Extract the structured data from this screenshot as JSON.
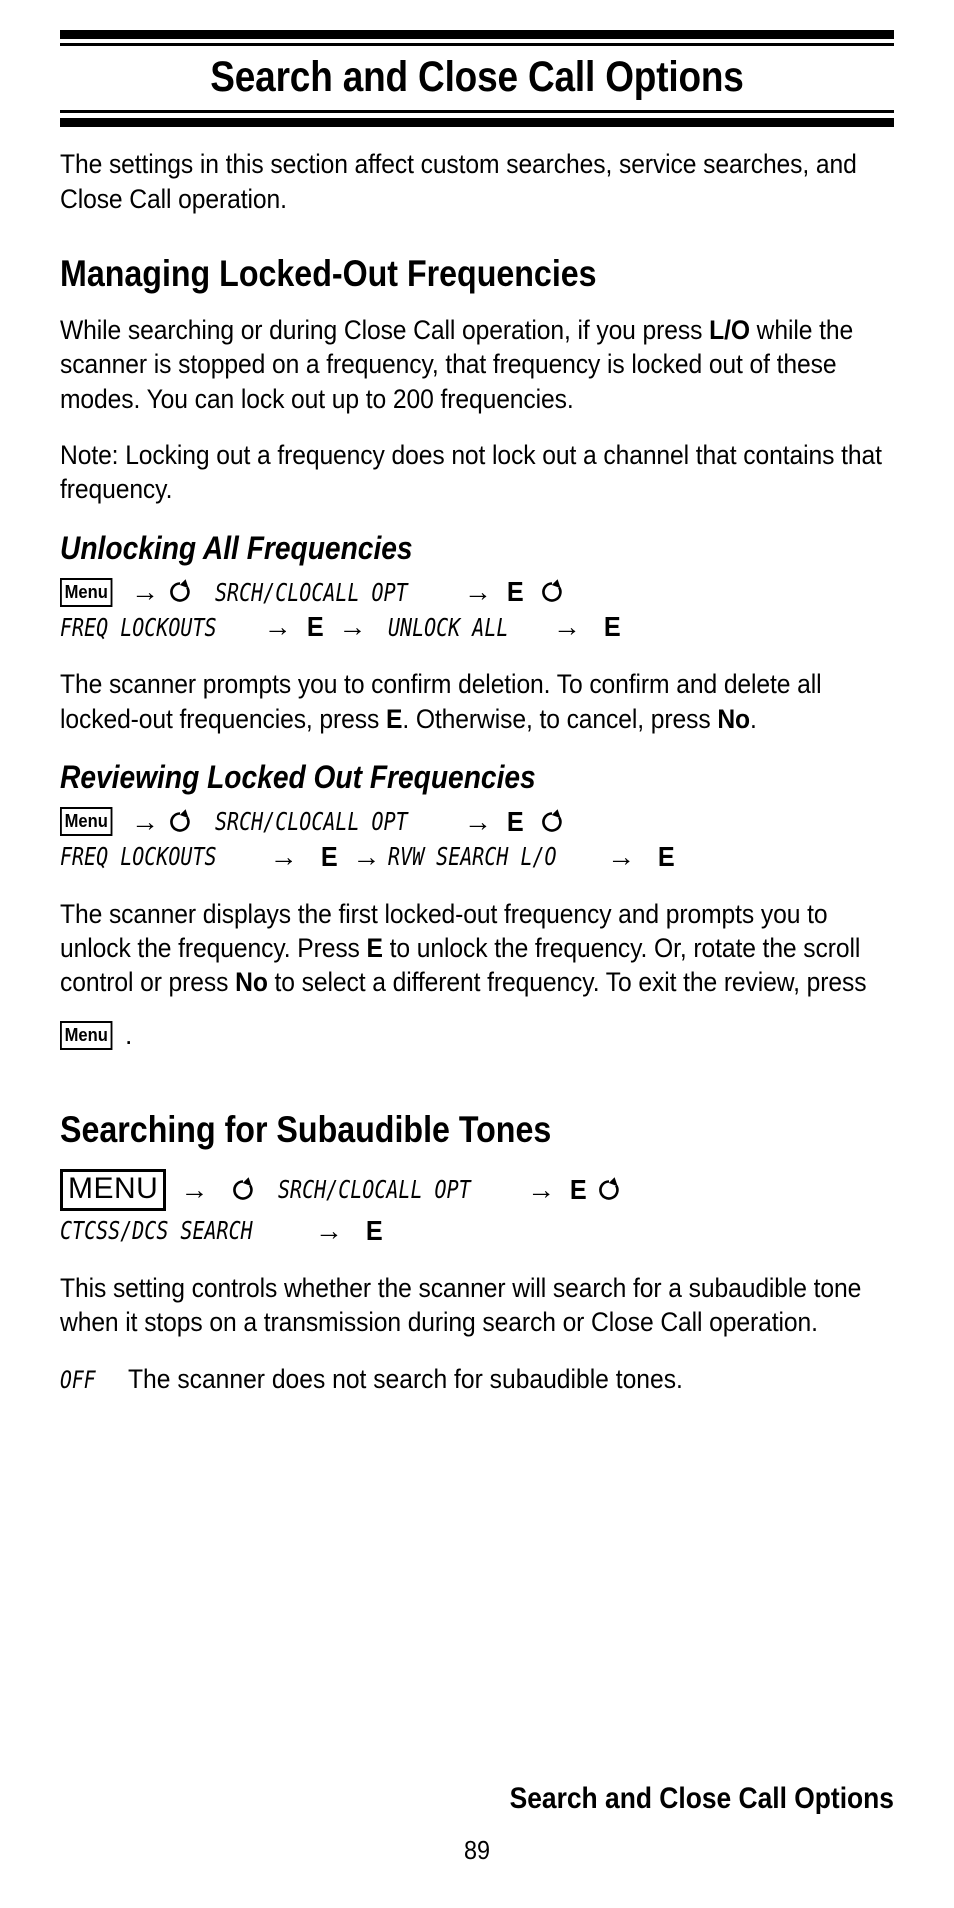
{
  "header": {
    "title": "Search and Close Call Options"
  },
  "intro": {
    "text": "The settings in this section affect custom searches, service searches, and Close Call operation."
  },
  "sections": [
    {
      "heading": "Managing Locked-Out Frequencies",
      "paragraphs": [
        {
          "part1": "While searching or during Close Call operation, if you press ",
          "bold1": "L/O",
          "part2": " while the scanner is stopped on a frequency, that frequency is locked out of these modes. You can lock out up to 200 frequencies."
        },
        {
          "text": "Note: Locking out a frequency does not lock out a channel that contains that frequency."
        }
      ],
      "subsections": [
        {
          "heading": "Unlocking All Frequencies",
          "keyseq": {
            "menu_label": "Menu",
            "arrow": "→",
            "rotate_icon": "rotate-scroll-icon",
            "lcd1": "SRCH/CLOCALL OPT",
            "e1": "E",
            "lcd2": "FREQ LOCKOUTS",
            "e2": "E",
            "lcd3": "UNLOCK ALL",
            "e3": "E"
          },
          "body": {
            "part1": "The scanner prompts you to confirm deletion. To confirm and delete all locked-out frequencies, press ",
            "bold1": "E",
            "part2": ". Otherwise, to cancel, press ",
            "bold2": "No",
            "part3": "."
          }
        },
        {
          "heading": "Reviewing Locked Out Frequencies",
          "keyseq": {
            "menu_label": "Menu",
            "arrow": "→",
            "rotate_icon": "rotate-scroll-icon",
            "lcd1": "SRCH/CLOCALL OPT",
            "e1": "E",
            "lcd2": "FREQ LOCKOUTS",
            "e2": "E",
            "lcd3": "RVW SEARCH L/O",
            "e3": "E"
          },
          "body": {
            "part1": "The scanner displays the first locked-out frequency and prompts you to unlock the frequency. Press ",
            "bold1": "E",
            "part2": " to unlock the frequency. Or, rotate the scroll control or press ",
            "bold2": "No",
            "part3": " to select a different frequency. To exit the review, press ",
            "menu_chip": "Menu",
            "part4": "."
          }
        }
      ]
    },
    {
      "heading": "Searching for Subaudible Tones",
      "keyseq": {
        "menu_label": "MENU",
        "arrow": "→",
        "rotate_icon": "rotate-scroll-icon",
        "lcd1": "SRCH/CLOCALL OPT",
        "e1": "E",
        "lcd2": "CTCSS/DCS SEARCH",
        "e2": "E"
      },
      "body": {
        "text": "This setting controls whether the scanner will search for a subaudible tone when it stops on a transmission during search or Close Call operation."
      },
      "options": [
        {
          "key": "OFF",
          "description": "The scanner does not search for subaudible tones."
        }
      ]
    }
  ],
  "footer": {
    "title": "Search and Close Call Options",
    "page_number": "89"
  }
}
